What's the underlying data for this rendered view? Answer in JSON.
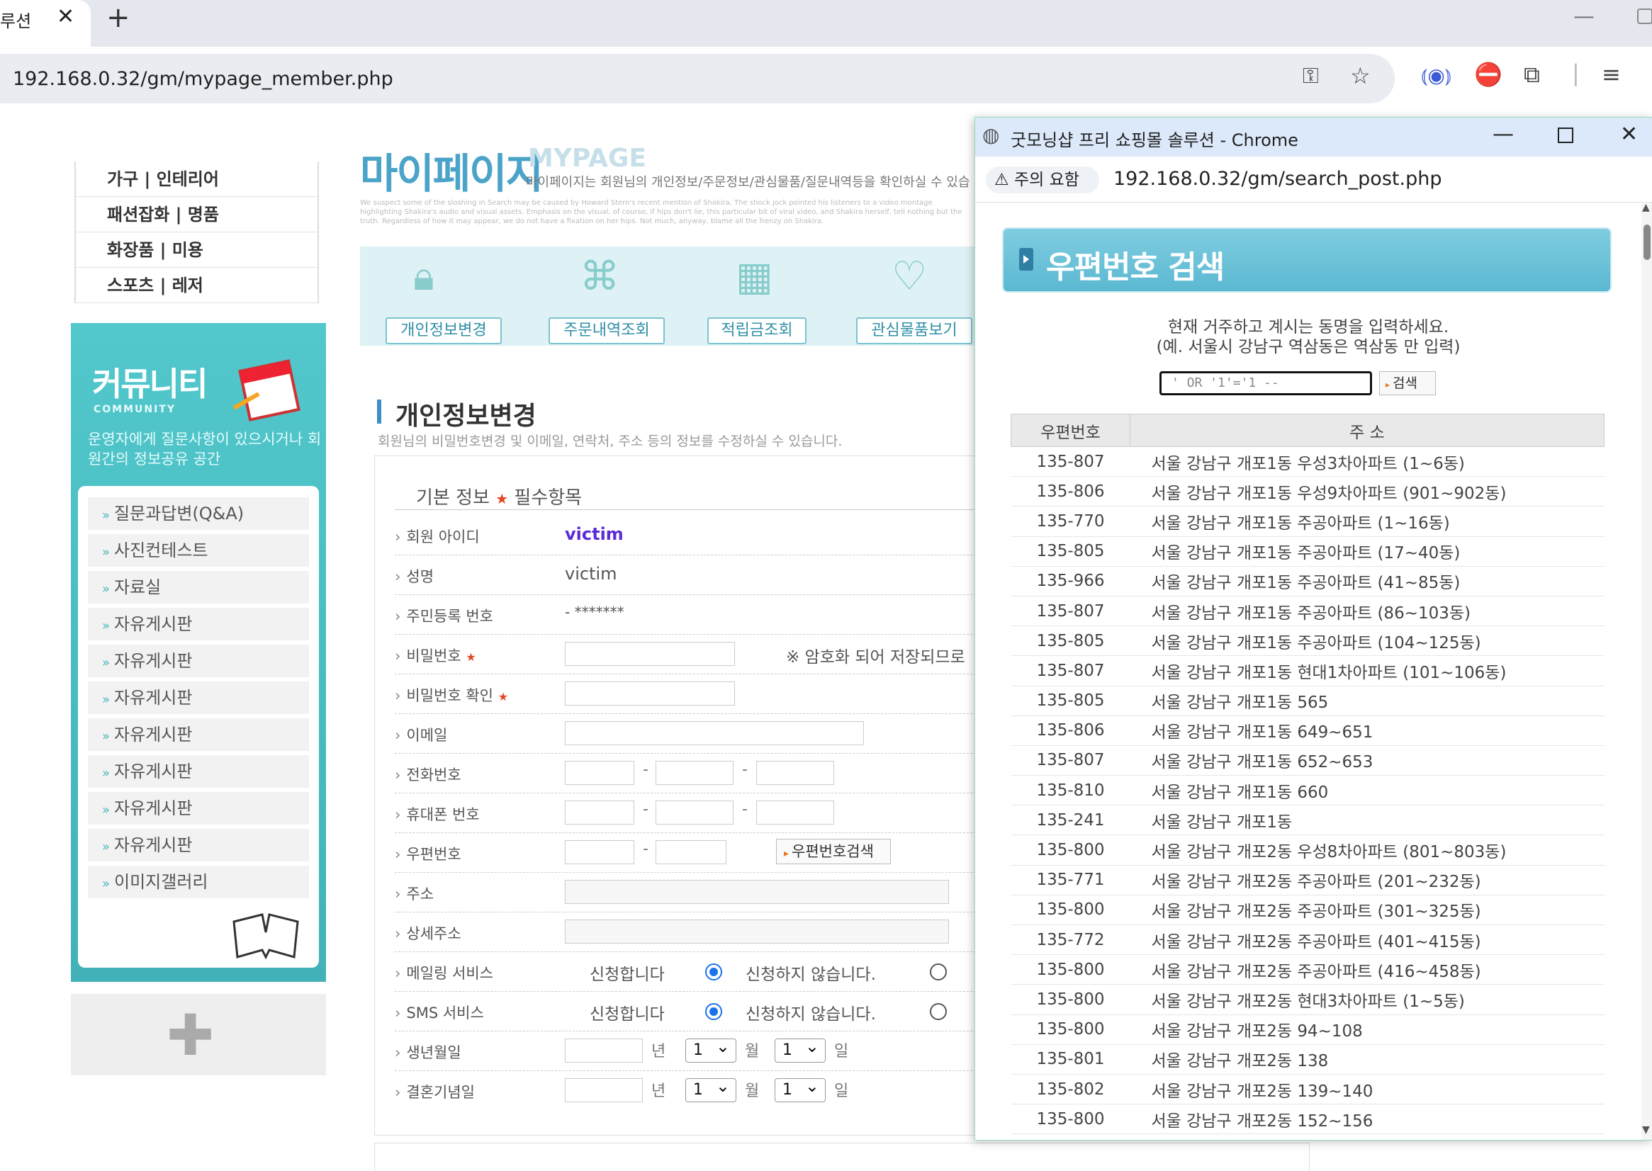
{
  "browser": {
    "tab_title": "루션",
    "url": "192.168.0.32/gm/mypage_member.php"
  },
  "sidebar": {
    "categories": [
      {
        "label": "가구 | 인테리어"
      },
      {
        "label": "패션잡화 | 명품"
      },
      {
        "label": "화장품 | 미용"
      },
      {
        "label": "스포츠 | 레저"
      }
    ],
    "community": {
      "title": "커뮤니티",
      "subtitle": "COMMUNITY",
      "description": "운영자에게 질문사항이 있으시거나 회원간의 정보공유 공간",
      "items": [
        {
          "label": "질문과답변(Q&A)"
        },
        {
          "label": "사진컨테스트"
        },
        {
          "label": "자료실"
        },
        {
          "label": "자유게시판"
        },
        {
          "label": "자유게시판"
        },
        {
          "label": "자유게시판"
        },
        {
          "label": "자유게시판"
        },
        {
          "label": "자유게시판"
        },
        {
          "label": "자유게시판"
        },
        {
          "label": "자유게시판"
        },
        {
          "label": "이미지갤러리"
        }
      ]
    }
  },
  "mypage": {
    "title": "마이페이지",
    "english": "MYPAGE",
    "description": "마이페이지는 회원님의 개인정보/주문정보/관심물품/질문내역등을 확인하실 수 있습",
    "fine_print": "We suspect some of the sloshing in Search may be caused by Howard Stern's recent mention of Shakira. The shock jock pointed his listeners to a video montage highlighting Shakira's audio and visual assets. Emphasis on the visual, of course, if hips don't lie, this particular bit of viral video, and Shakira herself, tell nothing but the truth. Regardless of how it may appear, we do not have a fixation on her hips. Not much, anyway, blame all the frenzy on Shakira.",
    "tabs": [
      {
        "label": "개인정보변경"
      },
      {
        "label": "주문내역조회"
      },
      {
        "label": "적립금조회"
      },
      {
        "label": "관심물품보기"
      }
    ]
  },
  "form": {
    "section_title": "개인정보변경",
    "section_desc": "회원님의 비밀번호변경 및 이메일, 연락처, 주소 등의 정보를 수정하실 수 있습니다.",
    "box_title": "기본 정보",
    "required_note": "필수항목",
    "rows": {
      "member_id": {
        "label": "회원 아이디",
        "value": "victim"
      },
      "name": {
        "label": "성명",
        "value": "victim"
      },
      "ssn": {
        "label": "주민등록 번호",
        "value": "- *******"
      },
      "password": {
        "label": "비밀번호",
        "note": "※ 암호화 되어 저장되므로"
      },
      "password_confirm": {
        "label": "비밀번호 확인"
      },
      "email": {
        "label": "이메일"
      },
      "phone": {
        "label": "전화번호"
      },
      "mobile": {
        "label": "휴대폰 번호"
      },
      "zipcode": {
        "label": "우편번호",
        "button": "우편번호검색"
      },
      "address": {
        "label": "주소"
      },
      "address_detail": {
        "label": "상세주소"
      },
      "mailing": {
        "label": "메일링 서비스",
        "yes": "신청합니다",
        "no": "신청하지 않습니다.",
        "selected": "yes"
      },
      "sms": {
        "label": "SMS 서비스",
        "yes": "신청합니다",
        "no": "신청하지 않습니다.",
        "selected": "yes"
      },
      "birthday": {
        "label": "생년월일",
        "year_unit": "년",
        "month": "1",
        "month_unit": "월",
        "day": "1",
        "day_unit": "일"
      },
      "anniversary": {
        "label": "결혼기념일",
        "year_unit": "년",
        "month": "1",
        "month_unit": "월",
        "day": "1",
        "day_unit": "일"
      }
    }
  },
  "popup": {
    "title": "굿모닝샵 프리 쇼핑몰 솔루션 - Chrome",
    "security_warning": "주의 요함",
    "url": "192.168.0.32/gm/search_post.php",
    "header": "우편번호 검색",
    "instruction_line1": "현재 거주하고 계시는 동명을 입력하세요.",
    "instruction_line2": "(예. 서울시 강남구 역삼동은 역삼동 만 입력)",
    "search_value": "' OR '1'='1 --",
    "search_button": "검색",
    "table": {
      "col_zip": "우편번호",
      "col_addr": "주 소",
      "rows": [
        {
          "zip": "135-807",
          "addr": "서울 강남구 개포1동 우성3차아파트  (1∼6동)"
        },
        {
          "zip": "135-806",
          "addr": "서울 강남구 개포1동 우성9차아파트  (901∼902동)"
        },
        {
          "zip": "135-770",
          "addr": "서울 강남구 개포1동 주공아파트  (1∼16동)"
        },
        {
          "zip": "135-805",
          "addr": "서울 강남구 개포1동 주공아파트  (17∼40동)"
        },
        {
          "zip": "135-966",
          "addr": "서울 강남구 개포1동 주공아파트  (41∼85동)"
        },
        {
          "zip": "135-807",
          "addr": "서울 강남구 개포1동 주공아파트  (86∼103동)"
        },
        {
          "zip": "135-805",
          "addr": "서울 강남구 개포1동 주공아파트  (104∼125동)"
        },
        {
          "zip": "135-807",
          "addr": "서울 강남구 개포1동 현대1차아파트  (101∼106동)"
        },
        {
          "zip": "135-805",
          "addr": "서울 강남구 개포1동  565"
        },
        {
          "zip": "135-806",
          "addr": "서울 강남구 개포1동  649∼651"
        },
        {
          "zip": "135-807",
          "addr": "서울 강남구 개포1동  652∼653"
        },
        {
          "zip": "135-810",
          "addr": "서울 강남구 개포1동  660"
        },
        {
          "zip": "135-241",
          "addr": "서울 강남구 개포1동"
        },
        {
          "zip": "135-800",
          "addr": "서울 강남구 개포2동 우성8차아파트  (801∼803동)"
        },
        {
          "zip": "135-771",
          "addr": "서울 강남구 개포2동 주공아파트  (201∼232동)"
        },
        {
          "zip": "135-800",
          "addr": "서울 강남구 개포2동 주공아파트  (301∼325동)"
        },
        {
          "zip": "135-772",
          "addr": "서울 강남구 개포2동 주공아파트  (401∼415동)"
        },
        {
          "zip": "135-800",
          "addr": "서울 강남구 개포2동 주공아파트  (416∼458동)"
        },
        {
          "zip": "135-800",
          "addr": "서울 강남구 개포2동 현대3차아파트  (1∼5동)"
        },
        {
          "zip": "135-800",
          "addr": "서울 강남구 개포2동  94∼108"
        },
        {
          "zip": "135-801",
          "addr": "서울 강남구 개포2동  138"
        },
        {
          "zip": "135-802",
          "addr": "서울 강남구 개포2동  139∼140"
        },
        {
          "zip": "135-800",
          "addr": "서울 강남구 개포2동  152∼156"
        }
      ]
    }
  }
}
